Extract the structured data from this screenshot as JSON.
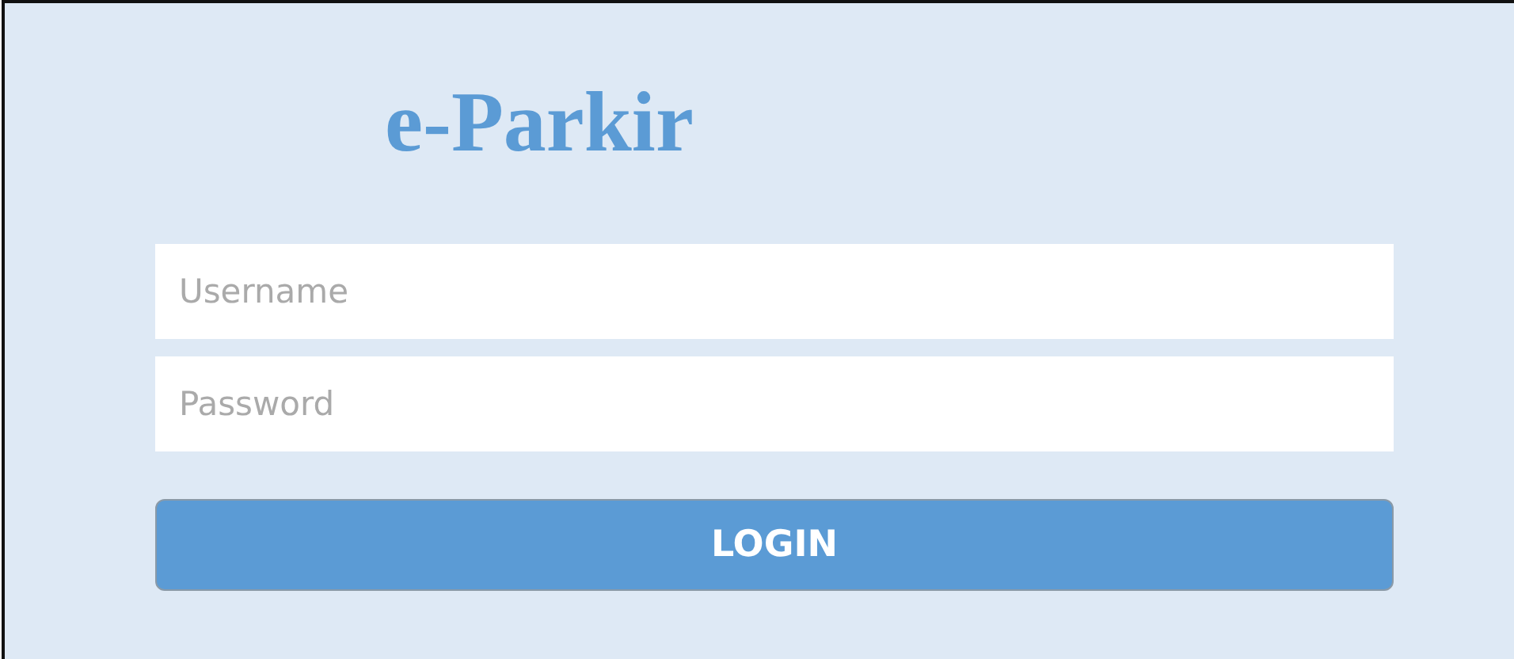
{
  "logo": {
    "text": "e-Parkir"
  },
  "fields": [
    {
      "placeholder": "Username"
    },
    {
      "placeholder": "Password"
    }
  ],
  "button": {
    "label": "LOGIN"
  }
}
